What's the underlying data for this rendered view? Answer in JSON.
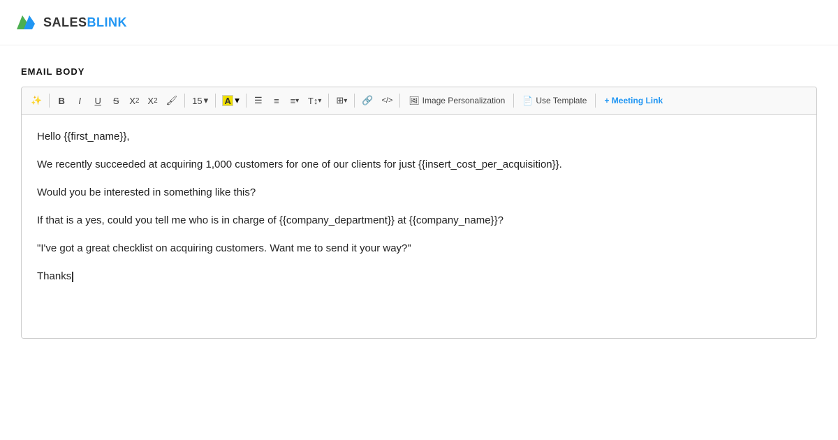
{
  "header": {
    "logo_sales": "SALES",
    "logo_blink": "BLINK"
  },
  "section": {
    "label": "EMAIL BODY"
  },
  "toolbar": {
    "magic_icon": "✨",
    "bold_label": "B",
    "italic_label": "I",
    "underline_label": "U",
    "strikethrough_label": "S",
    "superscript_label": "X²",
    "subscript_label": "X₂",
    "clear_label": "⌫",
    "font_size": "15",
    "font_size_dropdown": "▾",
    "color_letter": "A",
    "color_dropdown": "▾",
    "list_ordered_label": "☰",
    "list_unordered_label": "≡",
    "align_label": "≡",
    "text_style_label": "T↕",
    "table_label": "⊞",
    "link_label": "🔗",
    "code_label": "</>",
    "image_personalization_label": "Image Personalization",
    "use_template_label": "Use Template",
    "meeting_link_label": "+ Meeting Link"
  },
  "editor": {
    "line1": "Hello {{first_name}},",
    "line2": "We recently succeeded at acquiring 1,000 customers for one of our clients for just {{insert_cost_per_acquisition}}.",
    "line3": "Would you be interested in something like this?",
    "line4": "If that is a yes, could you tell me who is in charge of {{company_department}} at {{company_name}}?",
    "line5": "\"I've got a great checklist on acquiring customers. Want me to send it your way?\"",
    "line6": "Thanks"
  }
}
